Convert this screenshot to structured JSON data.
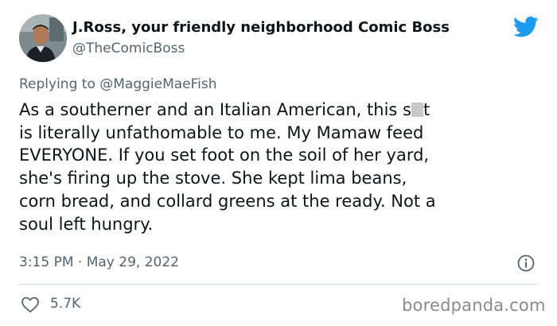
{
  "author": {
    "display_name": "J.Ross, your friendly neighborhood Comic Boss",
    "handle": "@TheComicBoss",
    "avatar_icon": "profile-photo"
  },
  "reply": {
    "prefix": "Replying to ",
    "mention": "@MaggieMaeFish"
  },
  "tweet": {
    "text_before_censor": "As a southerner and an Italian American, this s",
    "text_after_censor": "t\nis literally unfathomable to me. My Mamaw feed\nEVERYONE. If you set foot on the soil of her yard,\nshe's firing up the stove. She kept lima beans,\ncorn bread, and collard greens at the ready. Not a\nsoul left hungry.",
    "timestamp": "3:15 PM · May 29, 2022"
  },
  "engagement": {
    "likes": "5.7K"
  },
  "watermark": "boredpanda.com",
  "colors": {
    "text_primary": "#0f1419",
    "text_secondary": "#536471",
    "twitter_blue": "#1d9bf0",
    "divider": "#cfd9de"
  },
  "icons": {
    "logo": "twitter-bird-icon",
    "info": "info-icon",
    "like": "heart-icon"
  }
}
